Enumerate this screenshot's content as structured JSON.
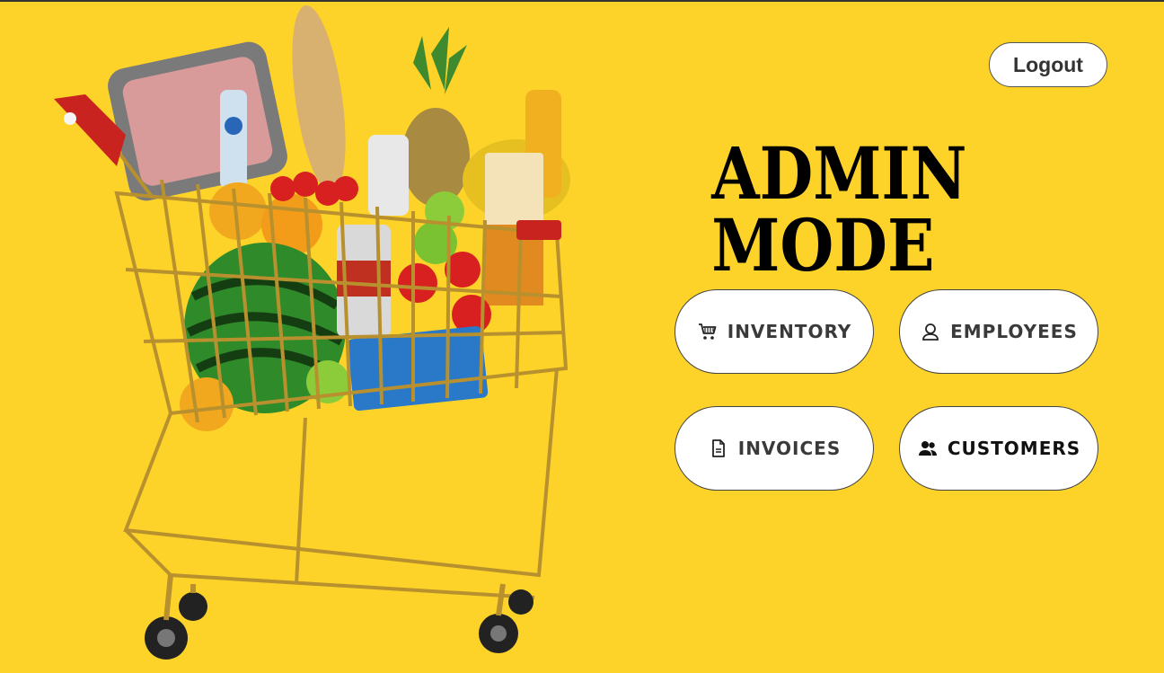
{
  "colors": {
    "background": "#FDD329",
    "button_bg": "#FFFFFF",
    "text_dark": "#000000"
  },
  "header": {
    "logout_label": "Logout"
  },
  "main": {
    "title": "ADMIN MODE",
    "menu": [
      {
        "label": "INVENTORY",
        "icon": "shopping-cart-icon"
      },
      {
        "label": "EMPLOYEES",
        "icon": "user-icon"
      },
      {
        "label": "INVOICES",
        "icon": "document-icon"
      },
      {
        "label": "CUSTOMERS",
        "icon": "users-icon"
      }
    ]
  },
  "hero": {
    "icon": "shopping-cart-with-groceries-image"
  }
}
